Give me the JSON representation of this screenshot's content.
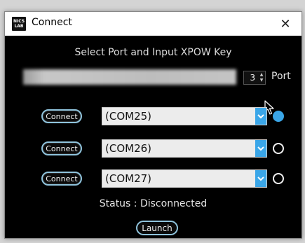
{
  "window": {
    "title": "Connect",
    "app_icon_lines": [
      "NICS",
      "LAB"
    ],
    "close_glyph": "✕"
  },
  "main": {
    "heading": "Select Port and Input XPOW Key",
    "key_input": {
      "value": "",
      "placeholder": ""
    },
    "port_spinner": {
      "value": "3",
      "up_glyph": "▲",
      "down_glyph": "▼"
    },
    "port_label": "Port",
    "rows": [
      {
        "button_label": "Connect",
        "port": "(COM25)",
        "selected": true
      },
      {
        "button_label": "Connect",
        "port": "(COM26)",
        "selected": false
      },
      {
        "button_label": "Connect",
        "port": "(COM27)",
        "selected": false
      }
    ],
    "status_text": "Status :  Disconnected",
    "launch_label": "Launch"
  },
  "colors": {
    "accent": "#3aa6e8",
    "window_bg": "#000000",
    "button_border": "#8fc3dc"
  }
}
